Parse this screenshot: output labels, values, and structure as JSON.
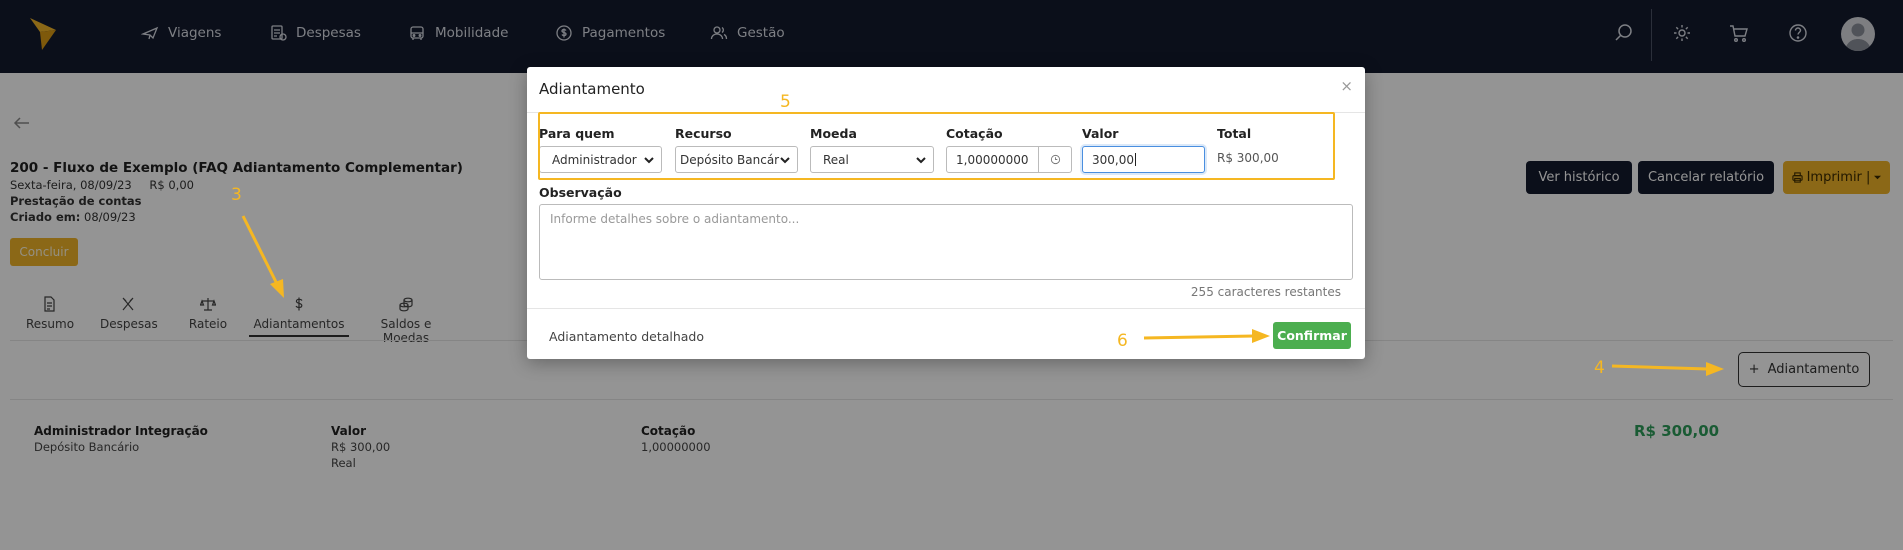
{
  "nav": {
    "items": [
      {
        "label": "Viagens",
        "icon": "plane-icon"
      },
      {
        "label": "Despesas",
        "icon": "receipt-icon"
      },
      {
        "label": "Mobilidade",
        "icon": "car-icon"
      },
      {
        "label": "Pagamentos",
        "icon": "dollar-circle-icon"
      },
      {
        "label": "Gestão",
        "icon": "users-icon"
      }
    ],
    "right_icons": [
      "search-icon",
      "gear-icon",
      "cart-icon",
      "help-icon",
      "avatar-icon"
    ]
  },
  "report": {
    "title": "200 - Fluxo de Exemplo (FAQ Adiantamento Complementar)",
    "date": "Sexta-feira, 08/09/23",
    "amount": "R$ 0,00",
    "type": "Prestação de contas",
    "created_label": "Criado em:",
    "created_value": "08/09/23",
    "conclude_label": "Concluir"
  },
  "actions": {
    "history": "Ver histórico",
    "cancel": "Cancelar relatório",
    "print": "Imprimir |"
  },
  "tabs": [
    {
      "label": "Resumo",
      "icon": "document-icon"
    },
    {
      "label": "Despesas",
      "icon": "utensils-icon"
    },
    {
      "label": "Rateio",
      "icon": "scale-icon"
    },
    {
      "label": "Adiantamentos",
      "icon": "dollar-icon",
      "active": true
    },
    {
      "label": "Saldos e Moedas",
      "icon": "coins-icon"
    }
  ],
  "add_advance_label": "Adiantamento",
  "advance_row": {
    "name": "Administrador Integração",
    "resource": "Depósito Bancário",
    "value_label": "Valor",
    "value": "R$ 300,00",
    "currency": "Real",
    "rate_label": "Cotação",
    "rate": "1,00000000",
    "total": "R$ 300,00"
  },
  "modal": {
    "title": "Adiantamento",
    "close": "×",
    "fields": {
      "para_quem": {
        "label": "Para quem",
        "value": "Administrador"
      },
      "recurso": {
        "label": "Recurso",
        "value": "Depósito Bancário"
      },
      "moeda": {
        "label": "Moeda",
        "value": "Real"
      },
      "cotacao": {
        "label": "Cotação",
        "value": "1,00000000"
      },
      "valor": {
        "label": "Valor",
        "value": "300,00"
      },
      "total": {
        "label": "Total",
        "value": "R$ 300,00"
      }
    },
    "observacao": {
      "label": "Observação",
      "placeholder": "Informe detalhes sobre o adiantamento...",
      "remaining": "255 caracteres restantes"
    },
    "detail_link": "Adiantamento detalhado",
    "confirm": "Confirmar"
  },
  "annotations": {
    "steps": [
      "3",
      "4",
      "5",
      "6"
    ],
    "color": "#f5b722"
  },
  "colors": {
    "nav_bg": "#141a2e",
    "accent_yellow": "#f0b429",
    "confirm_green": "#4cae4f",
    "total_green": "#2e9e5b"
  }
}
